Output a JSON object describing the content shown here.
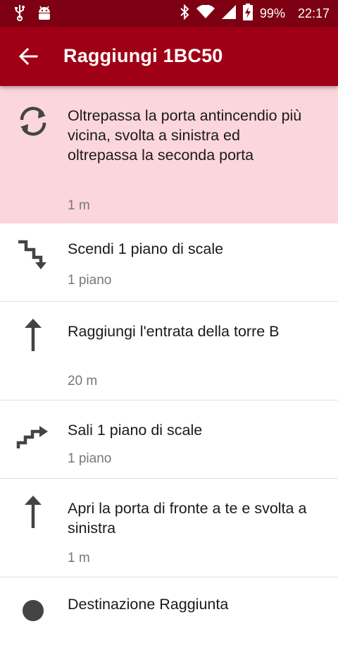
{
  "status_bar": {
    "battery": "99%",
    "time": "22:17",
    "icons": [
      "usb-icon",
      "android-icon",
      "bluetooth-icon",
      "wifi-icon",
      "signal-icon",
      "battery-charging-icon"
    ]
  },
  "app_bar": {
    "title": "Raggiungi 1BC50",
    "back_icon": "arrow-back-icon"
  },
  "steps": [
    {
      "icon": "refresh-icon",
      "text": "Oltrepassa la porta antincendio più vicina, svolta a sinistra ed oltrepassa la seconda porta",
      "distance": "1 m",
      "active": true
    },
    {
      "icon": "stairs-down-icon",
      "text": "Scendi 1 piano di scale",
      "distance": "1 piano",
      "active": false
    },
    {
      "icon": "arrow-up-icon",
      "text": "Raggiungi l'entrata della torre B",
      "distance": "20 m",
      "active": false
    },
    {
      "icon": "stairs-up-icon",
      "text": "Sali 1 piano di scale",
      "distance": "1 piano",
      "active": false
    },
    {
      "icon": "arrow-up-icon",
      "text": "Apri la porta di fronte a te e svolta a sinistra",
      "distance": "1 m",
      "active": false
    },
    {
      "icon": "destination-icon",
      "text": "Destinazione Raggiunta",
      "distance": "",
      "active": false
    }
  ],
  "colors": {
    "statusbar": "#7d0013",
    "appbar": "#a00016",
    "active_row": "#fcd6dd"
  }
}
